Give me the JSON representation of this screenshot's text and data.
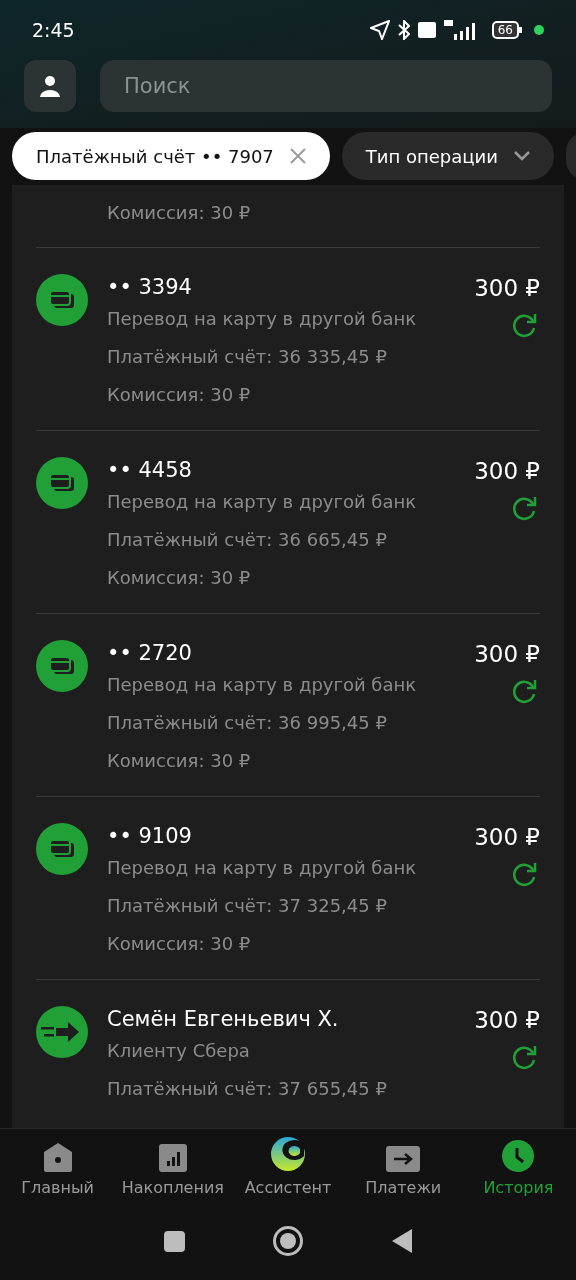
{
  "status_bar": {
    "time": "2:45",
    "battery": "66"
  },
  "search": {
    "placeholder": "Поиск"
  },
  "filters": [
    {
      "label": "Платёжный счёт •• 7907",
      "selected": true,
      "kind": "clear"
    },
    {
      "label": "Тип операции",
      "selected": false,
      "kind": "dropdown"
    },
    {
      "kind": "cut",
      "selected": false
    }
  ],
  "partial_row": {
    "details": [
      "Комиссия: 30 ₽"
    ]
  },
  "transactions": [
    {
      "kind": "card",
      "title": "•• 3394",
      "amount": "300 ₽",
      "details": [
        "Перевод на карту в другой банк",
        "Платёжный счёт: 36 335,45 ₽",
        "Комиссия: 30 ₽"
      ]
    },
    {
      "kind": "card",
      "title": "•• 4458",
      "amount": "300 ₽",
      "details": [
        "Перевод на карту в другой банк",
        "Платёжный счёт: 36 665,45 ₽",
        "Комиссия: 30 ₽"
      ]
    },
    {
      "kind": "card",
      "title": "•• 2720",
      "amount": "300 ₽",
      "details": [
        "Перевод на карту в другой банк",
        "Платёжный счёт: 36 995,45 ₽",
        "Комиссия: 30 ₽"
      ]
    },
    {
      "kind": "card",
      "title": "•• 9109",
      "amount": "300 ₽",
      "details": [
        "Перевод на карту в другой банк",
        "Платёжный счёт: 37 325,45 ₽",
        "Комиссия: 30 ₽"
      ]
    },
    {
      "kind": "transfer",
      "title": "Семён Евгеньевич Х.",
      "amount": "300 ₽",
      "details": [
        "Клиенту Сбера",
        "Платёжный счёт: 37 655,45 ₽"
      ]
    }
  ],
  "nav": [
    {
      "kind": "home",
      "label": "Главный",
      "selected": false
    },
    {
      "kind": "savings",
      "label": "Накопления",
      "selected": false
    },
    {
      "kind": "assistant",
      "label": "Ассистент",
      "selected": false
    },
    {
      "kind": "payments",
      "label": "Платежи",
      "selected": false
    },
    {
      "kind": "history",
      "label": "История",
      "selected": true
    }
  ]
}
